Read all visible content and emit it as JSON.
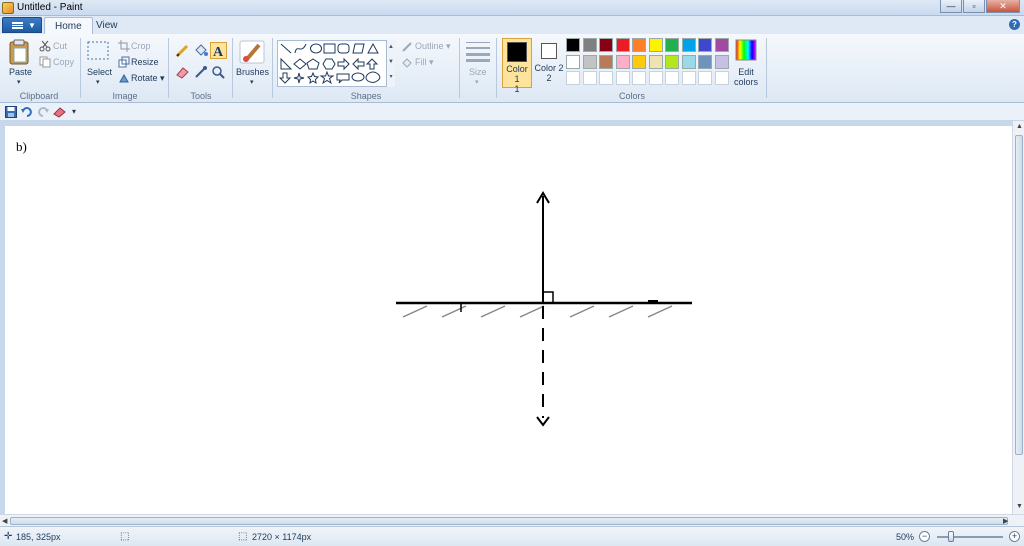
{
  "window": {
    "title": "Untitled - Paint",
    "minimize": "—",
    "maximize": "▫",
    "close": "✕"
  },
  "tabs": [
    {
      "label": "Home"
    },
    {
      "label": "View"
    }
  ],
  "ribbon": {
    "clipboard": {
      "paste": "Paste",
      "cut": "Cut",
      "copy": "Copy",
      "label": "Clipboard"
    },
    "image": {
      "select": "Select",
      "crop": "Crop",
      "resize": "Resize",
      "rotate": "Rotate",
      "label": "Image"
    },
    "tools": {
      "label": "Tools"
    },
    "brushes": {
      "label": "Brushes"
    },
    "shapes": {
      "outline": "Outline",
      "fill": "Fill",
      "label": "Shapes"
    },
    "size": {
      "label": "Size"
    },
    "colors": {
      "color1": "Color 1",
      "color1_num": "1",
      "color2": "Color 2",
      "color2_num": "2",
      "color1_value": "#000000",
      "color2_value": "#ffffff",
      "edit": "Edit colors",
      "label": "Colors",
      "palette_row1": [
        "#000000",
        "#7f7f7f",
        "#880015",
        "#ed1c24",
        "#ff7f27",
        "#fff200",
        "#22b14c",
        "#00a2e8",
        "#3f48cc",
        "#a349a4"
      ],
      "palette_row2": [
        "#ffffff",
        "#c3c3c3",
        "#b97a57",
        "#ffaec9",
        "#ffc90e",
        "#efe4b0",
        "#b5e61d",
        "#99d9ea",
        "#7092be",
        "#c8bfe7"
      ]
    }
  },
  "canvas": {
    "label_text": "b)"
  },
  "status": {
    "cursor": "185, 325px",
    "canvas_size": "2720 × 1174px",
    "zoom": "50%",
    "zoom_level": 0.5
  }
}
